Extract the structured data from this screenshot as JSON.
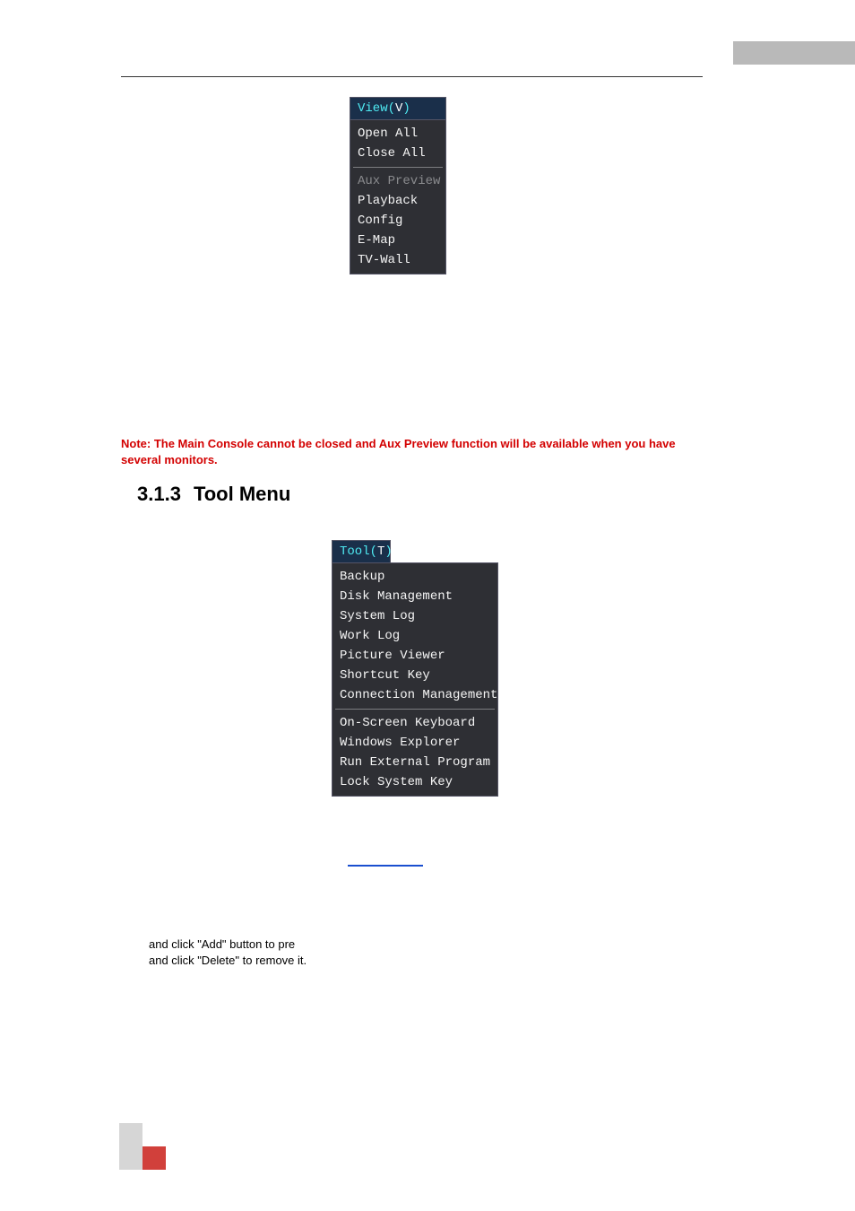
{
  "menus": {
    "view": {
      "title_prefix": "View(",
      "title_letter": "V",
      "title_suffix": ")",
      "group1": [
        "Open All",
        "Close All"
      ],
      "group2": [
        {
          "label": "Aux Preview",
          "disabled": true
        },
        {
          "label": "Playback",
          "disabled": false
        },
        {
          "label": "Config",
          "disabled": false
        },
        {
          "label": "E-Map",
          "disabled": false
        },
        {
          "label": "TV-Wall",
          "disabled": false
        }
      ]
    },
    "tool": {
      "title_prefix": "Tool(",
      "title_letter": "T",
      "title_suffix": ")",
      "group1": [
        "Backup",
        "Disk Management",
        "System Log",
        "Work Log",
        "Picture Viewer",
        "Shortcut Key",
        "Connection Management"
      ],
      "group2": [
        "On-Screen Keyboard",
        "Windows Explorer",
        "Run External Program",
        "Lock System Key"
      ]
    }
  },
  "note_text": "Note: The Main Console cannot be closed and Aux Preview function will be available when you have several monitors.",
  "heading_number": "3.1.3",
  "heading_text": "Tool Menu",
  "body_line1": "and click \"Add\" button to pre",
  "body_line2": "and click \"Delete\" to remove it."
}
